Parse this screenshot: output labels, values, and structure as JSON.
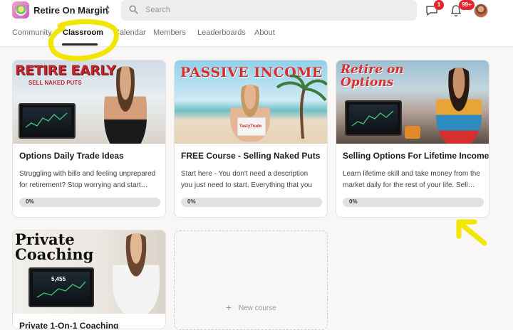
{
  "header": {
    "group_name": "Retire On Margin",
    "search_placeholder": "Search",
    "chat_badge": "1",
    "notifications_badge": "99+"
  },
  "tabs": [
    {
      "label": "Community",
      "active": false
    },
    {
      "label": "Classroom",
      "active": true
    },
    {
      "label": "Calendar",
      "active": false
    },
    {
      "label": "Members",
      "active": false
    },
    {
      "label": "Leaderboards",
      "active": false
    },
    {
      "label": "About",
      "active": false
    }
  ],
  "courses": [
    {
      "title": "Options Daily Trade Ideas",
      "description": "Struggling with bills and feeling unprepared for retirement? Stop worrying and start…",
      "progress_label": "0%",
      "progress": 0,
      "thumb_title": "RETIRE EARLY",
      "thumb_subtitle": "SELL NAKED PUTS"
    },
    {
      "title": "FREE Course - Selling Naked Puts",
      "description": "Start here - You don't need a description you just need to start. Everything that you need…",
      "progress_label": "0%",
      "progress": 0,
      "thumb_title": "PASSIVE INCOME",
      "thumb_subtitle": "TastyTrade"
    },
    {
      "title": "Selling Options For Lifetime Income",
      "description": "Learn lifetime skill and take money from the market daily for the rest of your life. Sell…",
      "progress_label": "0%",
      "progress": 0,
      "thumb_title": "Retire on Options"
    },
    {
      "title": "Private 1-On-1 Coaching",
      "thumb_title_line1": "Private",
      "thumb_title_line2": "Coaching",
      "screen_value": "5,455"
    }
  ],
  "new_course": {
    "label": "New course"
  },
  "colors": {
    "annotation": "#f2e600",
    "badge": "#e5262e"
  }
}
